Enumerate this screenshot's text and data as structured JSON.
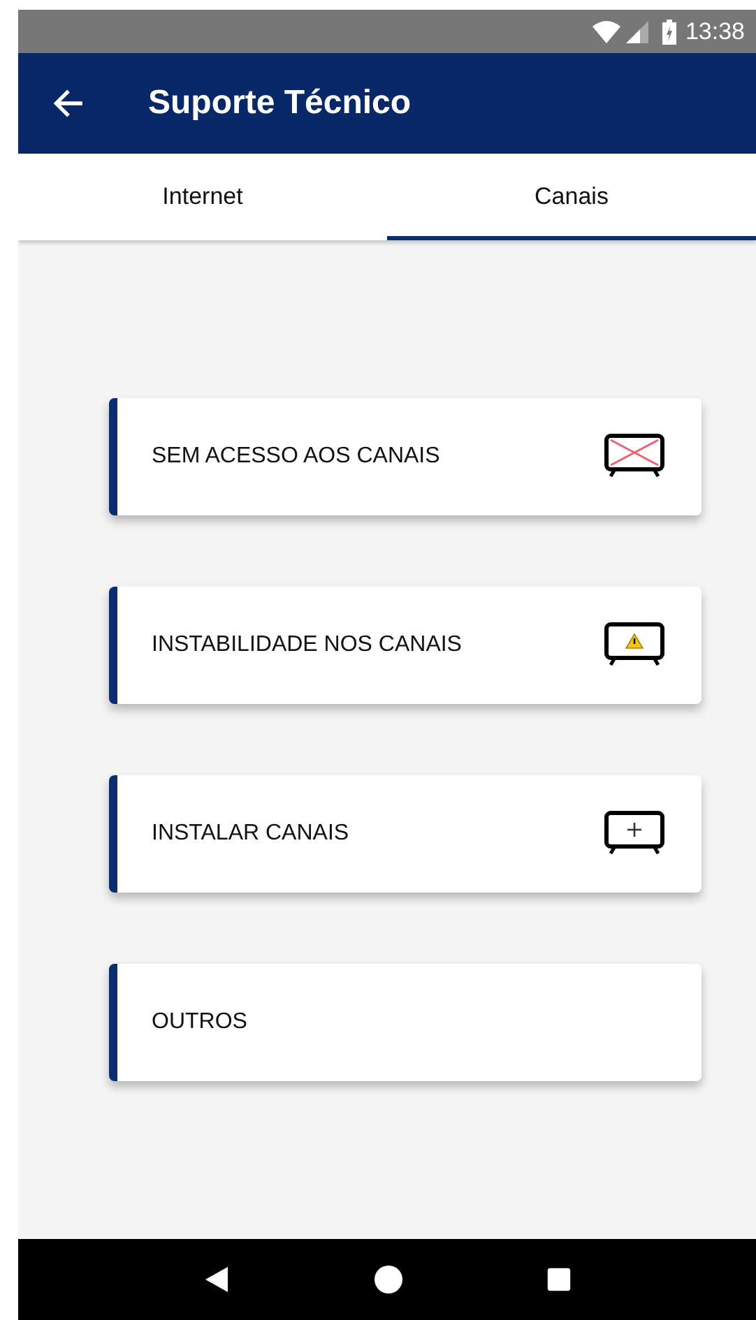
{
  "status_bar": {
    "time": "13:38"
  },
  "app_bar": {
    "title": "Suporte Técnico"
  },
  "tabs": [
    {
      "label": "Internet",
      "selected": false
    },
    {
      "label": "Canais",
      "selected": true
    }
  ],
  "options": [
    {
      "label": "SEM ACESSO AOS CANAIS",
      "kind": "crossed"
    },
    {
      "label": "INSTABILIDADE NOS CANAIS",
      "kind": "warning"
    },
    {
      "label": "INSTALAR CANAIS",
      "kind": "install"
    },
    {
      "label": "OUTROS",
      "kind": "other"
    }
  ]
}
